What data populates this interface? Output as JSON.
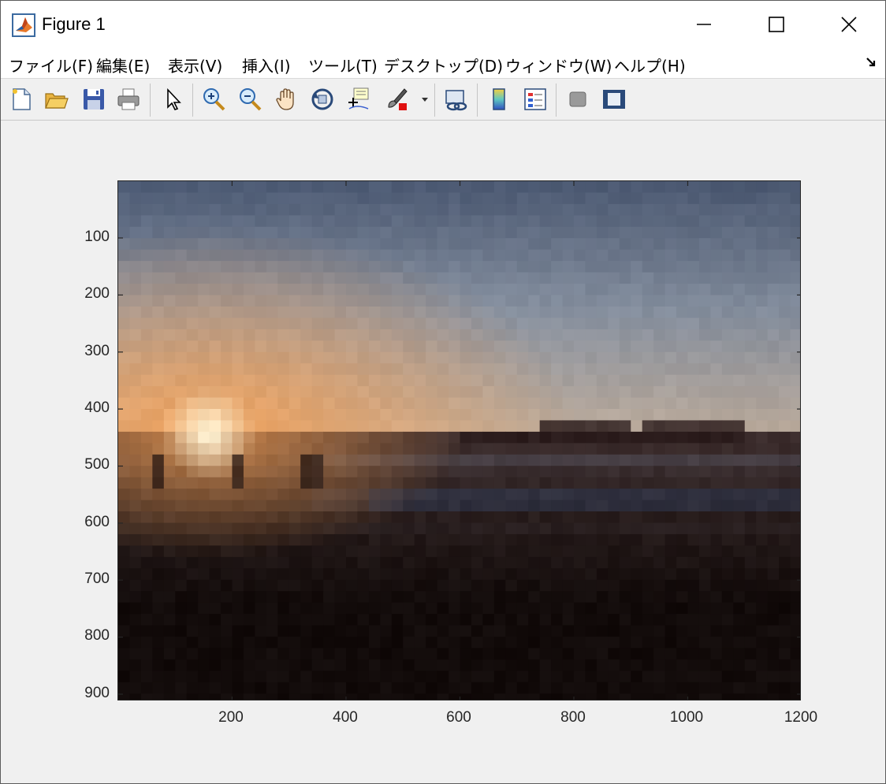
{
  "window": {
    "title": "Figure 1",
    "icon": "matlab-icon",
    "controls": [
      "minimize-icon",
      "maximize-icon",
      "close-icon"
    ]
  },
  "menubar": {
    "items": [
      {
        "label": "ファイル(F)"
      },
      {
        "label": "編集(E)"
      },
      {
        "label": "表示(V)"
      },
      {
        "label": "挿入(I)"
      },
      {
        "label": "ツール(T)"
      },
      {
        "label": "デスクトップ(D)"
      },
      {
        "label": "ウィンドウ(W)"
      },
      {
        "label": "ヘルプ(H)"
      }
    ],
    "dock_icon": "dock-arrow-icon"
  },
  "toolbar": {
    "buttons": [
      "new-figure-icon",
      "open-file-icon",
      "save-icon",
      "print-icon",
      "select-pointer-icon",
      "zoom-in-icon",
      "zoom-out-icon",
      "pan-hand-icon",
      "rotate-3d-icon",
      "data-cursor-icon",
      "brush-icon",
      "link-plot-icon",
      "colorbar-icon",
      "legend-icon",
      "hide-plot-tools-icon",
      "show-plot-tools-icon"
    ]
  },
  "axes": {
    "image_description": "pixelated sunset over sea",
    "yticks": [
      "100",
      "200",
      "300",
      "400",
      "500",
      "600",
      "700",
      "800",
      "900"
    ],
    "xticks": [
      "200",
      "400",
      "600",
      "800",
      "1000",
      "1200"
    ],
    "xlim": [
      1,
      1200
    ],
    "ylim": [
      1,
      912
    ],
    "colors": {
      "sky_top": "#4d5a72",
      "sky_mid": "#8f98a6",
      "horizon_glow": "#f0a060",
      "sun": "#fff6d8",
      "sea_dark": "#1a1212",
      "ground": "#120b09"
    }
  }
}
